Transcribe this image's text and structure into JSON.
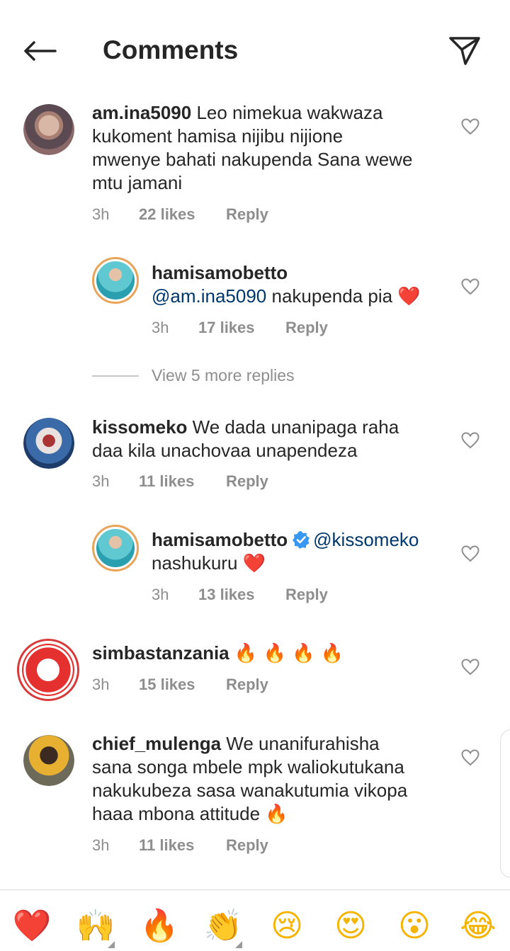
{
  "header": {
    "title": "Comments"
  },
  "comments": [
    {
      "username": "am.ina5090",
      "text": " Leo nimekua wakwaza",
      "lines": [
        "kukoment hamisa nijibu nijione",
        "mwenye bahati nakupenda Sana wewe",
        "mtu jamani"
      ],
      "time": "3h",
      "likes": "22 likes",
      "reply": "Reply"
    },
    {
      "username": "hamisamobetto",
      "mention": "@am.ina5090",
      "text": " nakupenda pia ",
      "emoji": "❤️",
      "time": "3h",
      "likes": "17 likes",
      "reply": "Reply"
    },
    {
      "username": "kissomeko",
      "text": " We dada unanipaga raha",
      "lines": [
        "daa kila unachovaa unapendeza"
      ],
      "time": "3h",
      "likes": "11 likes",
      "reply": "Reply"
    },
    {
      "username": "hamisamobetto",
      "mention": "@kissomeko",
      "line2": "nashukuru ",
      "emoji": "❤️",
      "time": "3h",
      "likes": "13 likes",
      "reply": "Reply"
    },
    {
      "username": "simbastanzania",
      "emoji": "🔥 🔥 🔥 🔥",
      "time": "3h",
      "likes": "15 likes",
      "reply": "Reply"
    },
    {
      "username": "chief_mulenga",
      "text": " We unanifurahisha",
      "lines": [
        "sana songa mbele mpk waliokutukana",
        "nakukubeza sasa wanakutumia vikopa",
        "haaa mbona attitude "
      ],
      "emoji": "🔥",
      "time": "3h",
      "likes": "11 likes",
      "reply": "Reply"
    }
  ],
  "view_more": "View 5 more replies",
  "emoji_bar": [
    "❤️",
    "🙌",
    "🔥",
    "👏",
    "😢",
    "😍",
    "😮",
    "😂"
  ],
  "colors": {
    "text": "#262626",
    "muted": "#8e8e8e",
    "mention": "#00376b",
    "verified": "#3897f0"
  }
}
